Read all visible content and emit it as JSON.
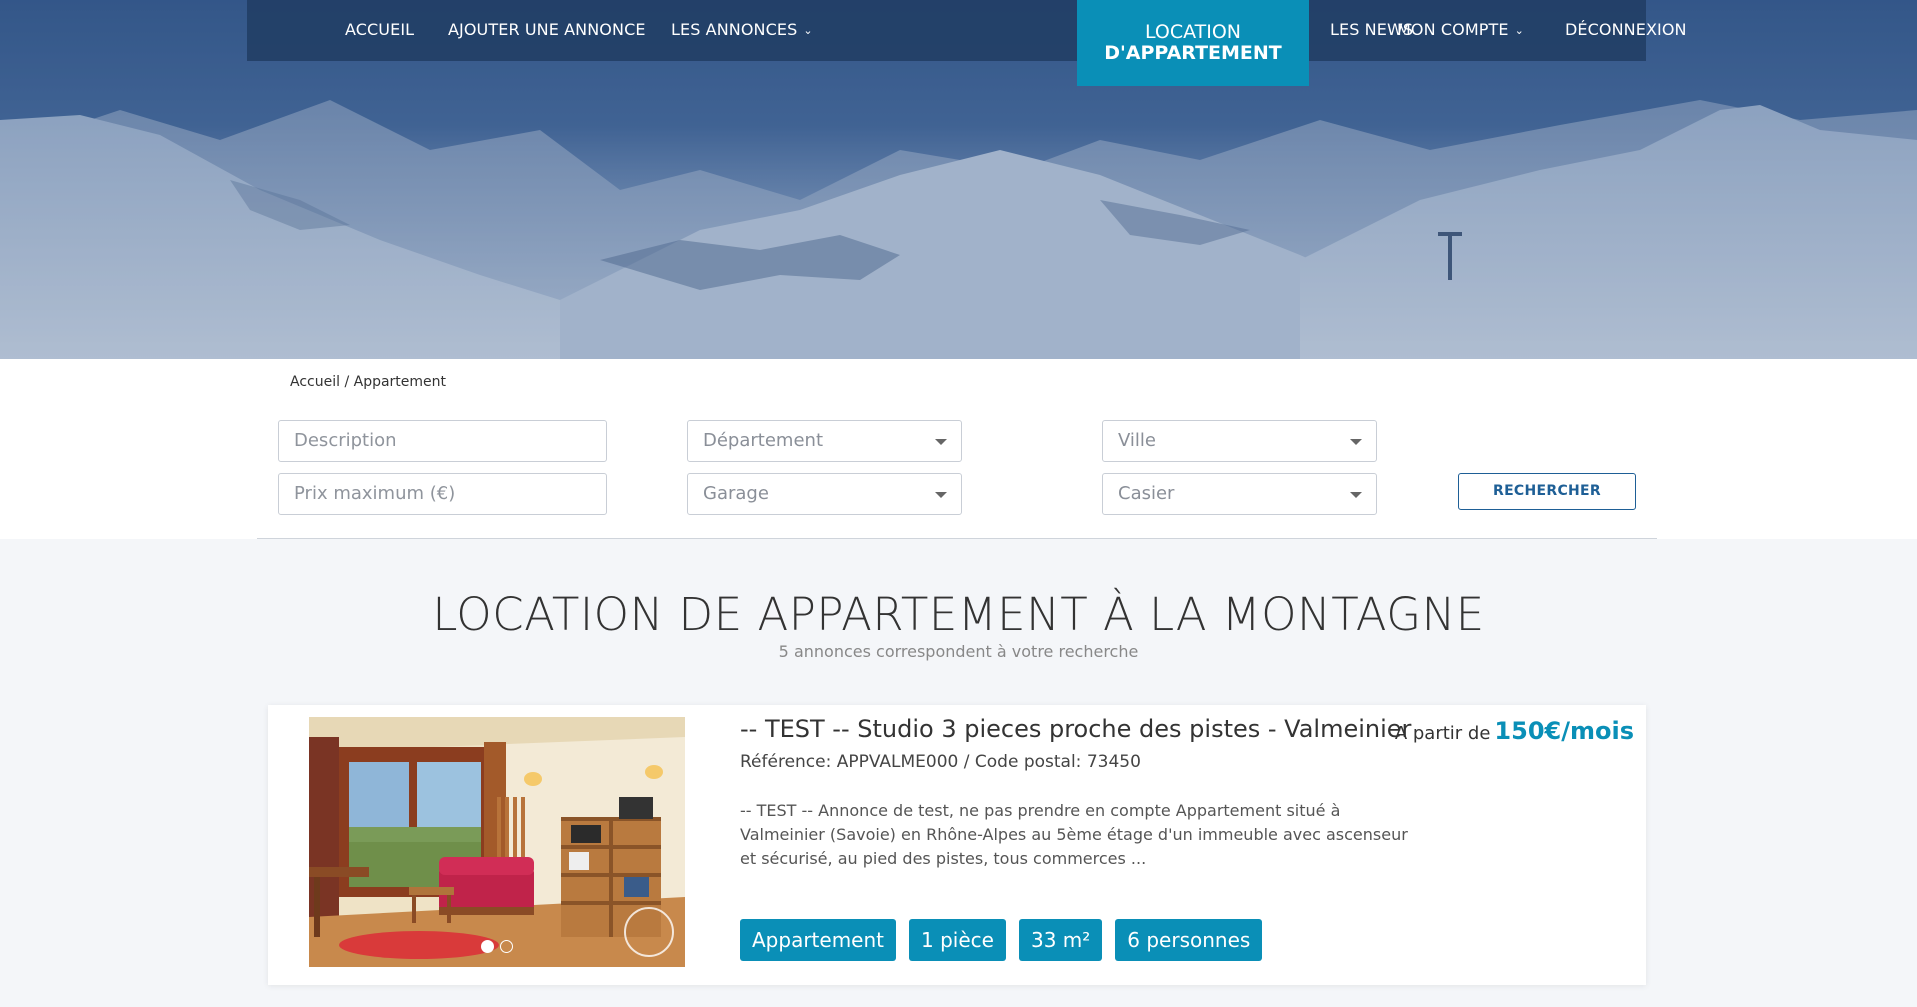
{
  "nav": {
    "items_left": [
      "ACCUEIL",
      "AJOUTER UNE ANNONCE",
      "LES ANNONCES"
    ],
    "brand_line1": "LOCATION",
    "brand_line2": "D'APPARTEMENT",
    "items_right": [
      "LES NEWS",
      "MON COMPTE",
      "DÉCONNEXION"
    ]
  },
  "breadcrumb": {
    "home": "Accueil",
    "separator": " / ",
    "current": "Appartement"
  },
  "search": {
    "description_placeholder": "Description",
    "departement_placeholder": "Département",
    "ville_placeholder": "Ville",
    "prix_placeholder": "Prix maximum (€)",
    "garage_placeholder": "Garage",
    "casier_placeholder": "Casier",
    "button": "RECHERCHER"
  },
  "results": {
    "title": "LOCATION DE APPARTEMENT À LA MONTAGNE",
    "count_text": "5 annonces correspondent à votre recherche"
  },
  "listing": {
    "title": "-- TEST -- Studio 3 pieces proche des pistes - Valmeinier",
    "reference": "Référence: APPVALME000 / Code postal: 73450",
    "description": "-- TEST -- Annonce de test, ne pas prendre en compte Appartement situé à Valmeinier (Savoie) en Rhône-Alpes au 5ème étage d'un immeuble avec ascenseur et sécurisé, au pied des pistes, tous commerces ...",
    "price_prefix": "A partir de",
    "price": "150€/mois",
    "tags": [
      "Appartement",
      "1 pièce",
      "33 m²",
      "6 personnes"
    ],
    "carousel_total": 2,
    "carousel_active": 1
  },
  "colors": {
    "brand": "#0a8fb7",
    "nav_bg": "#213e64",
    "button_border": "#1e5f96"
  }
}
